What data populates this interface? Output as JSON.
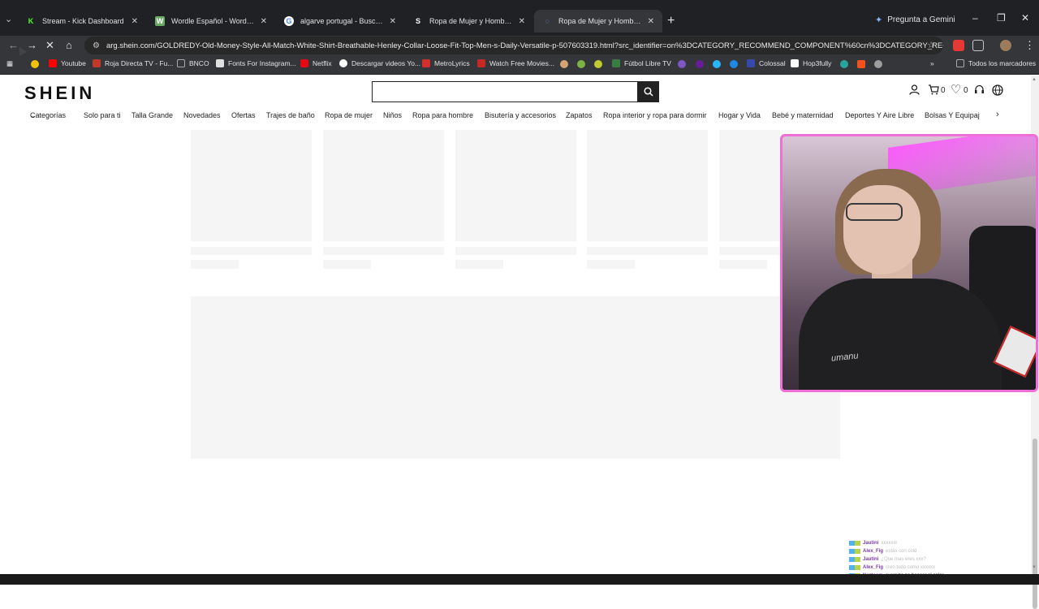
{
  "browser": {
    "tabs": [
      {
        "label": "Stream - Kick Dashboard",
        "favicon": "K",
        "favicon_color": "#53fc18",
        "active": false
      },
      {
        "label": "Wordle Español - Wordle ilimitado",
        "favicon": "W",
        "favicon_color": "#6aaa64",
        "active": false
      },
      {
        "label": "algarve portugal - Buscar con Google",
        "favicon": "G",
        "favicon_color": "#ffffff",
        "active": false
      },
      {
        "label": "Ropa de Mujer y Hombre, Compra",
        "favicon": "S",
        "favicon_color": "#202124",
        "active": false
      },
      {
        "label": "Ropa de Mujer y Hombre, Compra",
        "favicon": "◌",
        "favicon_color": "#35363a",
        "active": true
      }
    ],
    "new_tab": "+",
    "gemini_label": "Pregunta a Gemini",
    "url": "arg.shein.com/GOLDREDY-Old-Money-Style-All-Match-White-Shirt-Breathable-Henley-Collar-Loose-Fit-Top-Men-s-Daily-Versatile-p-507603319.html?src_identifier=on%3DCATEGORY_RECOMMEND_COMPONENT%60cn%3DCATEGORY_RECO...",
    "bookmarks": [
      {
        "label": "Youtube",
        "color": "#ff0000"
      },
      {
        "label": "Roja Directa TV - Fu...",
        "color": "#c0392b"
      },
      {
        "label": "BNCO",
        "color": "#8a8a8a"
      },
      {
        "label": "Fonts For Instagram...",
        "color": "#e0e0e0"
      },
      {
        "label": "Netflix",
        "color": "#e50914"
      },
      {
        "label": "Descargar videos Yo...",
        "color": "#ffffff"
      },
      {
        "label": "MetroLyrics",
        "color": "#d32f2f"
      },
      {
        "label": "Watch Free Movies...",
        "color": "#c62828"
      },
      {
        "label": "Fútbol Libre TV",
        "color": "#3a7d44"
      },
      {
        "label": "Colossal",
        "color": "#3949ab"
      },
      {
        "label": "Hop3fully",
        "color": "#ffffff"
      }
    ],
    "all_bookmarks_label": "Todos los marcadores"
  },
  "shein": {
    "logo": "SHEIN",
    "search_placeholder": "",
    "cart_count": "0",
    "wishlist_count": "0",
    "categories": [
      "Categorías",
      "Solo para ti",
      "Talla Grande",
      "Novedades",
      "Ofertas",
      "Trajes de baño",
      "Ropa de mujer",
      "Niños",
      "Ropa para hombre",
      "Bisutería y accesorios",
      "Zapatos",
      "Ropa interior y ropa para dormir",
      "Hogar y Vida",
      "Bebé y maternidad",
      "Deportes Y Aire Libre",
      "Bolsas Y Equipaje"
    ]
  },
  "overlay": {
    "shirt_text": "umanu",
    "chat": [
      {
        "user": "Jautini",
        "message": "xxxxxxl"
      },
      {
        "user": "Alex_Fig",
        "message": "estás con cold"
      },
      {
        "user": "Jautini",
        "message": "¿Que mas eres xxx?"
      },
      {
        "user": "Alex_Fig",
        "message": "creo todo como xxxxxx"
      },
      {
        "user": "Nezteam",
        "message": "oversize pa bancar el calor"
      }
    ]
  },
  "colors": {
    "accent_webcam_border": "#f06ed7",
    "skeleton": "#f5f5f5",
    "browser_dark": "#202124"
  }
}
